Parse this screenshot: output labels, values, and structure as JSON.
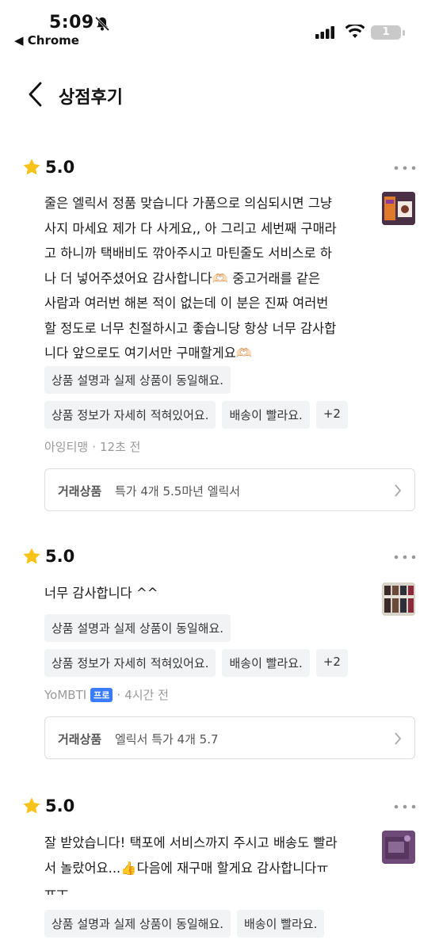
{
  "status": {
    "time": "5:09",
    "back_app": "◀ Chrome",
    "battery": "1"
  },
  "header": {
    "title": "상점후기"
  },
  "reviews": [
    {
      "rating": "5.0",
      "lines": [
        "줄은 엘릭서 정품 맞습니다 가품으로 의심되시면 그냥",
        "사지 마세요 제가 다 사게요,, 아 그리고 세번째 구매라",
        "고 하니까 택배비도 깎아주시고 마틴줄도 서비스로 하",
        "나 더 넣어주셨어요 감사합니다🫶🏻 중고거래를 같은",
        "사람과 여러번 해본 적이 없는데 이 분은 진짜 여러번",
        "할 정도로 너무 친절하시고 좋습니당 항상 너무 감사합",
        "니다 앞으로도 여기서만 구매할게요🫶🏻"
      ],
      "chips": [
        "상품 설명과 실제 상품이 동일해요.",
        "상품 정보가 자세히 적혀있어요.",
        "배송이 빨라요.",
        "+2"
      ],
      "author": "아잉티맹",
      "badge": "",
      "time": "12초 전",
      "product_label": "거래상품",
      "product_name": "특가 4개 5.5마년 엘릭서"
    },
    {
      "rating": "5.0",
      "lines": [
        "너무 감사합니다 ^^"
      ],
      "chips": [
        "상품 설명과 실제 상품이 동일해요.",
        "상품 정보가 자세히 적혀있어요.",
        "배송이 빨라요.",
        "+2"
      ],
      "author": "YoMBTI",
      "badge": "프로",
      "time": "4시간 전",
      "product_label": "거래상품",
      "product_name": "엘릭서 특가 4개 5.7"
    },
    {
      "rating": "5.0",
      "lines": [
        "잘 받았습니다! 택포에 서비스까지 주시고 배송도 빨라",
        "서 놀랐어요...👍다음에 재구매 할게요 감사합니다ㅠ",
        "ㅠㅜ"
      ],
      "chips": [
        "상품 설명과 실제 상품이 동일해요.",
        "배송이 빨라요."
      ]
    }
  ],
  "colors": {
    "star": "#f7c21a",
    "badge": "#3a7bff",
    "chip_bg": "#f2f3f5"
  }
}
